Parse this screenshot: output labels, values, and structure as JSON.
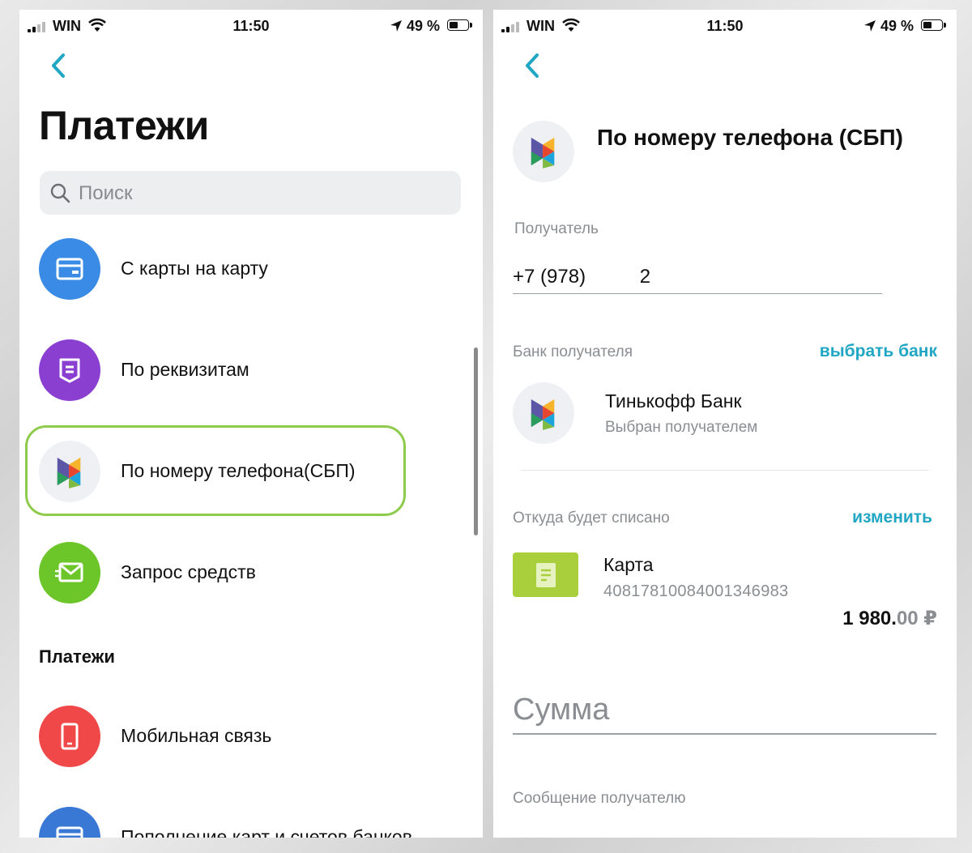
{
  "status_bar": {
    "carrier": "WIN",
    "time": "11:50",
    "battery": "49 %"
  },
  "left": {
    "title": "Платежи",
    "search_placeholder": "Поиск",
    "items": [
      {
        "label": "С карты на карту",
        "icon": "card-icon",
        "color": "#3a8be6"
      },
      {
        "label": "По реквизитам",
        "icon": "document-icon",
        "color": "#8b3fd1"
      },
      {
        "label": "По номеру телефона(СБП)",
        "icon": "sbp-logo-icon",
        "color": "#eef0f3"
      },
      {
        "label": "Запрос средств",
        "icon": "envelope-icon",
        "color": "#6cc62a"
      }
    ],
    "section_title": "Платежи",
    "section_items": [
      {
        "label": "Мобильная связь",
        "icon": "phone-icon",
        "color": "#f04848"
      },
      {
        "label": "Пополнение карт и счетов банков",
        "icon": "card-icon",
        "color": "#3a78d6"
      }
    ]
  },
  "right": {
    "title": "По номеру телефона (СБП)",
    "recipient_label": "Получатель",
    "phone_value": "+7 (978)          2",
    "bank_label": "Банк получателя",
    "choose_bank": "выбрать банк",
    "bank_name": "Тинькофф Банк",
    "bank_sub": "Выбран получателем",
    "source_label": "Откуда будет списано",
    "change": "изменить",
    "card_name": "Карта",
    "card_number": "40817810084001346983",
    "balance_main": "1 980.",
    "balance_cents": "00 ₽",
    "amount_placeholder": "Сумма",
    "message_placeholder": "Сообщение получателю"
  },
  "colors": {
    "accent": "#21a6c3",
    "highlight": "#8ecb4c",
    "back": "#21a6c3"
  }
}
